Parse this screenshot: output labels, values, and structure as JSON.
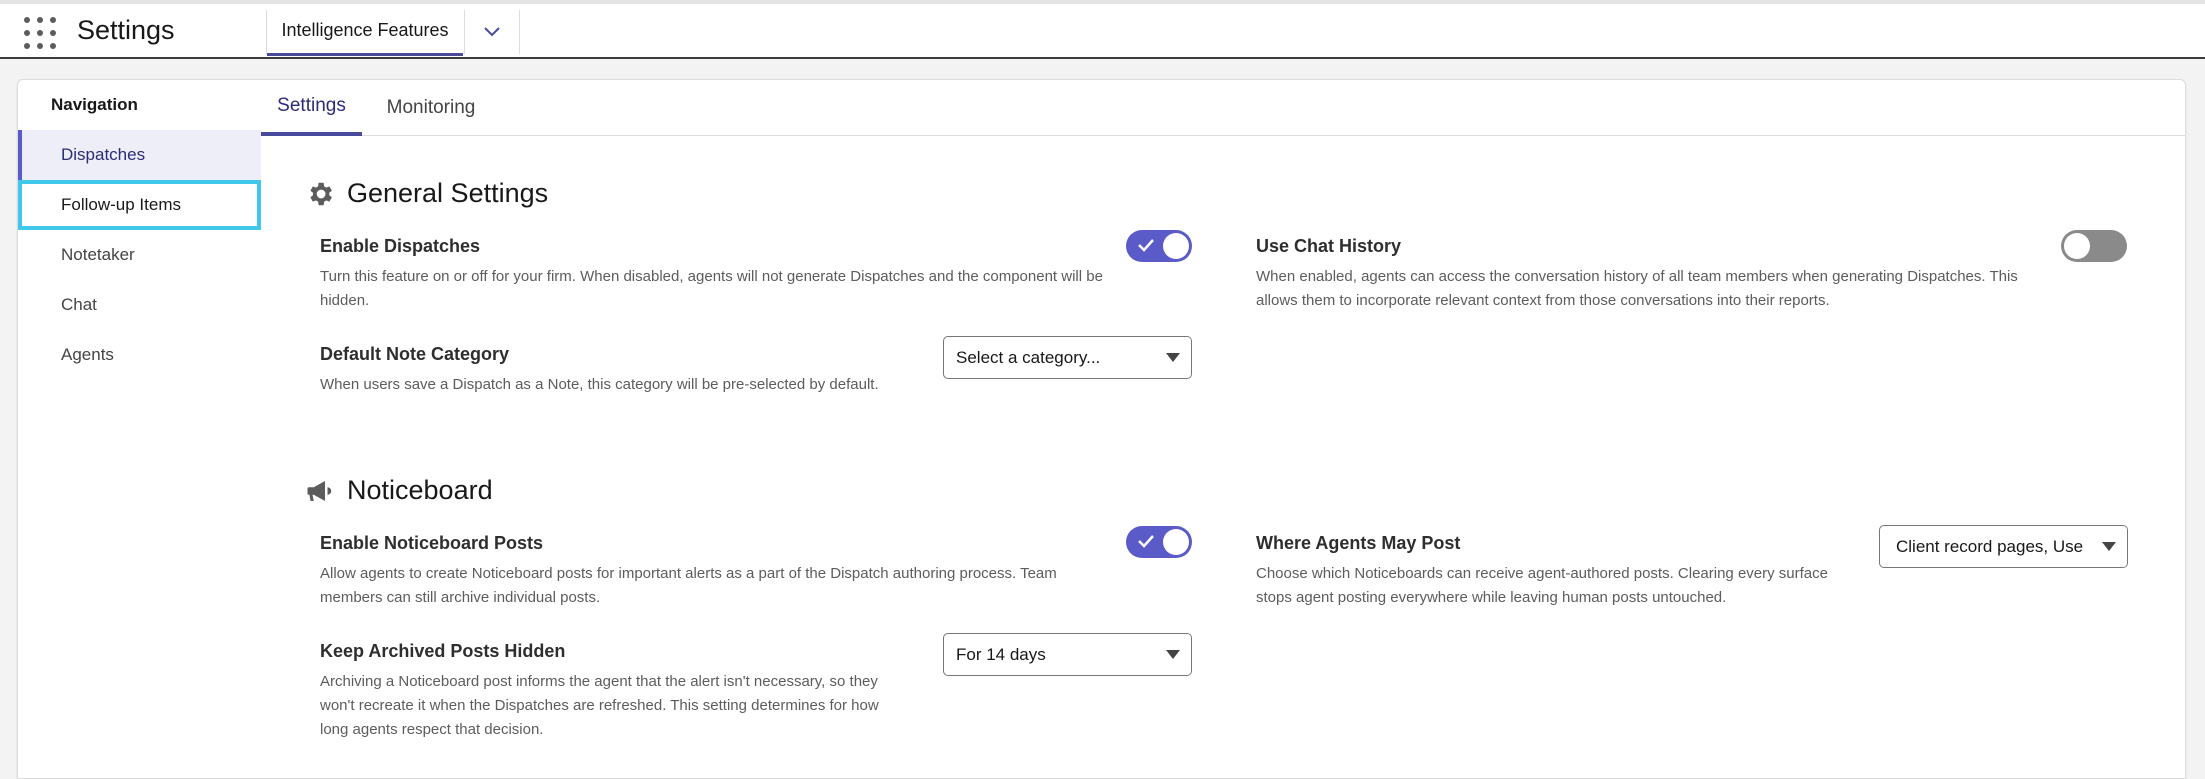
{
  "app": {
    "title": "Settings",
    "tab_label": "Intelligence Features"
  },
  "nav": {
    "heading": "Navigation",
    "items": [
      {
        "label": "Dispatches"
      },
      {
        "label": "Follow-up Items"
      },
      {
        "label": "Notetaker"
      },
      {
        "label": "Chat"
      },
      {
        "label": "Agents"
      }
    ]
  },
  "tabs": [
    {
      "label": "Settings"
    },
    {
      "label": "Monitoring"
    }
  ],
  "general": {
    "title": "General Settings",
    "enable_dispatches": {
      "label": "Enable Dispatches",
      "desc": "Turn this feature on or off for your firm. When disabled, agents will not generate Dispatches and the component will be hidden.",
      "state": "on"
    },
    "use_chat_history": {
      "label": "Use Chat History",
      "desc": "When enabled, agents can access the conversation history of all team members when generating Dispatches. This allows them to incorporate relevant context from those conversations into their reports.",
      "state": "off"
    },
    "default_note_category": {
      "label": "Default Note Category",
      "desc": "When users save a Dispatch as a Note, this category will be pre-selected by default.",
      "value": "Select a category..."
    }
  },
  "noticeboard": {
    "title": "Noticeboard",
    "enable_posts": {
      "label": "Enable Noticeboard Posts",
      "desc": "Allow agents to create Noticeboard posts for important alerts as a part of the Dispatch authoring process. Team members can still archive individual posts.",
      "state": "on"
    },
    "where_post": {
      "label": "Where Agents May Post",
      "desc": "Choose which Noticeboards can receive agent-authored posts. Clearing every surface stops agent posting everywhere while leaving human posts untouched.",
      "value": "Client record pages, Use"
    },
    "keep_hidden": {
      "label": "Keep Archived Posts Hidden",
      "desc": "Archiving a Noticeboard post informs the agent that the alert isn't necessary, so they won't recreate it when the Dispatches are refreshed. This setting determines for how long agents respect that decision.",
      "value": "For 14 days"
    }
  },
  "colors": {
    "accent": "#5a5ac8",
    "focus": "#40c8ea"
  }
}
